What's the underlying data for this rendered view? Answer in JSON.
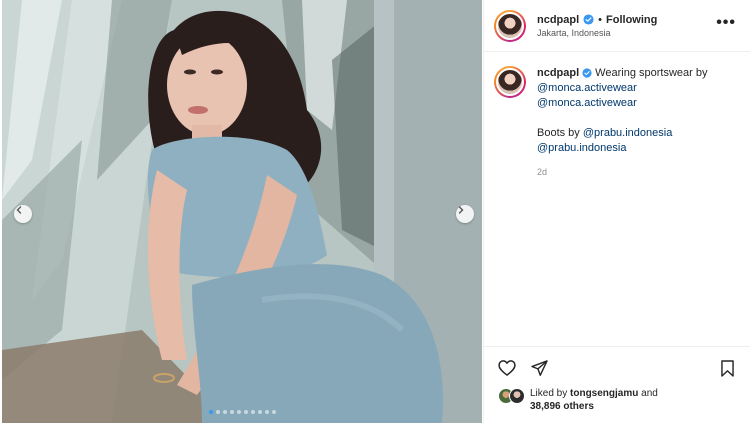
{
  "post": {
    "username": "ncdpapl",
    "follow_separator": "•",
    "follow_status": "Following",
    "location": "Jakarta, Indonesia",
    "more_label": "•••"
  },
  "caption": {
    "username": "ncdpapl",
    "text_prefix": "Wearing sportswear by",
    "mention1": "@monca.activewear",
    "mention2": "@monca.activewear",
    "boots_prefix": "Boots by",
    "mention3": "@prabu.indonesia",
    "mention4": "@prabu.indonesia",
    "time": "2d"
  },
  "likes": {
    "prefix": "Liked by",
    "user": "tongsengjamu",
    "conj": "and",
    "others": "38,896 others"
  },
  "posted_ago": "2 DAYS AGO",
  "carousel": {
    "total_slides": 10,
    "active_index": 0
  },
  "icons": {
    "prev": "chevron-left-icon",
    "next": "chevron-right-icon",
    "like": "heart-icon",
    "share": "paper-plane-icon",
    "save": "bookmark-icon",
    "verified": "verified-badge-icon"
  },
  "colors": {
    "verified_blue": "#3897f0",
    "mention_blue": "#00376b",
    "muted_text": "#8e8e8e"
  }
}
